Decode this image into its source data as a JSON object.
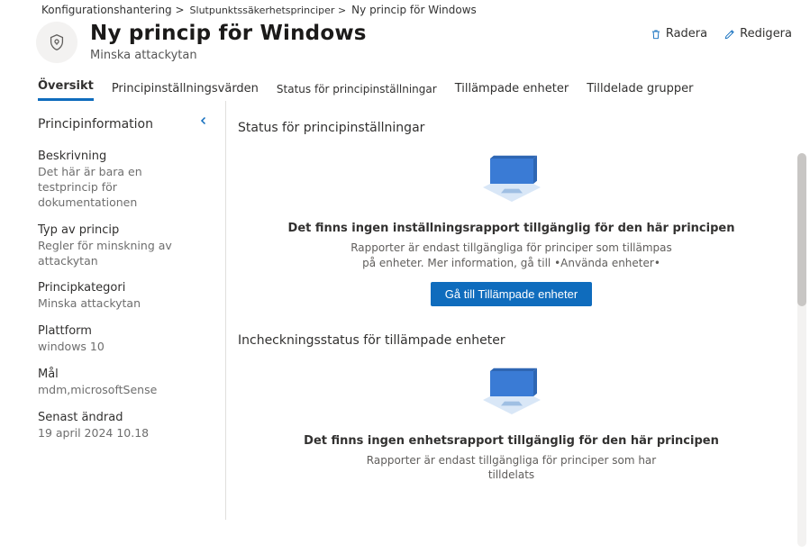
{
  "breadcrumb": {
    "item1": "Konfigurationshantering >",
    "item2": "Slutpunktssäkerhetsprinciper >",
    "item3": "Ny princip för Windows"
  },
  "header": {
    "title": "Ny princip för Windows",
    "subtitle": "Minska attackytan",
    "delete": "Radera",
    "edit": "Redigera"
  },
  "tabs": {
    "overview": "Översikt",
    "settings_values": "Principinställningsvärden",
    "settings_status": "Status för principinställningar",
    "applied_devices": "Tillämpade enheter",
    "assigned_groups": "Tilldelade grupper"
  },
  "sidebar": {
    "title": "Principinformation",
    "description_label": "Beskrivning",
    "description_value": "Det här är bara en testprincip för dokumentationen",
    "type_label": "Typ av princip",
    "type_value": "Regler för minskning av attackytan",
    "category_label": "Principkategori",
    "category_value": "Minska attackytan",
    "platform_label": "Plattform",
    "platform_value": "windows 10",
    "target_label": "Mål",
    "target_value": "mdm,microsoftSense",
    "modified_label": "Senast ändrad",
    "modified_value": "19 april 2024 10.18"
  },
  "main": {
    "section1_title": "Status för principinställningar",
    "section1_empty_title": "Det finns ingen inställningsrapport tillgänglig för den här principen",
    "section1_empty_sub": "Rapporter är endast tillgängliga för principer som tillämpas på enheter. Mer information, gå till •Använda enheter•",
    "section1_button": "Gå till Tillämpade enheter",
    "section2_title": "Incheckningsstatus för tillämpade enheter",
    "section2_empty_title": "Det finns ingen enhetsrapport tillgänglig för den här principen",
    "section2_empty_sub": "Rapporter är endast tillgängliga för principer som har tilldelats"
  }
}
